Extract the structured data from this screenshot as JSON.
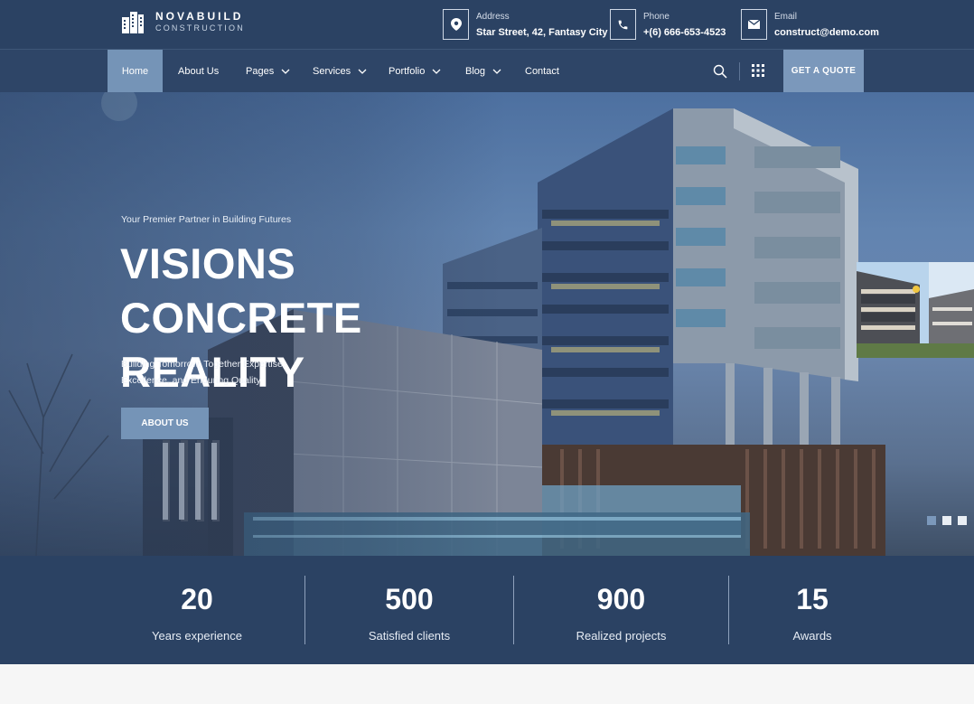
{
  "brand": {
    "name": "NOVABUILD",
    "tagline": "CONSTRUCTION",
    "logo_icon": "building-logo-icon"
  },
  "contact": [
    {
      "icon": "map-pin-icon",
      "label": "Address",
      "value": "Star Street, 42, Fantasy City"
    },
    {
      "icon": "phone-icon",
      "label": "Phone",
      "value": "+(6) 666-653-4523"
    },
    {
      "icon": "envelope-icon",
      "label": "Email",
      "value": "construct@demo.com"
    }
  ],
  "nav": {
    "items": [
      {
        "label": "Home",
        "active": true
      },
      {
        "label": "About Us",
        "dropdown": false
      },
      {
        "label": "Pages",
        "dropdown": true
      },
      {
        "label": "Services",
        "dropdown": true
      },
      {
        "label": "Portfolio",
        "dropdown": true
      },
      {
        "label": "Blog",
        "dropdown": true
      },
      {
        "label": "Contact",
        "dropdown": false
      }
    ],
    "search_icon": "search-icon",
    "grid_icon": "grid-menu-icon",
    "cta_label": "GET A QUOTE"
  },
  "hero": {
    "tagline": "Your Premier Partner in Building Futures",
    "title": "VISIONS CONCRETE REALITY",
    "description": "Building Tomorrow, Together Expertise, Excellence, and Enduring Quality",
    "button_label": "ABOUT US",
    "slides_total": 3,
    "active_slide": 1
  },
  "stats": [
    {
      "value": "20",
      "label": "Years experience"
    },
    {
      "value": "500",
      "label": "Satisfied clients"
    },
    {
      "value": "900",
      "label": "Realized projects"
    },
    {
      "value": "15",
      "label": "Awards"
    }
  ],
  "colors": {
    "primary_dark": "#2b4263",
    "nav_bg": "#2e4567",
    "accent": "#7594b7",
    "cta": "#7b98bb"
  }
}
